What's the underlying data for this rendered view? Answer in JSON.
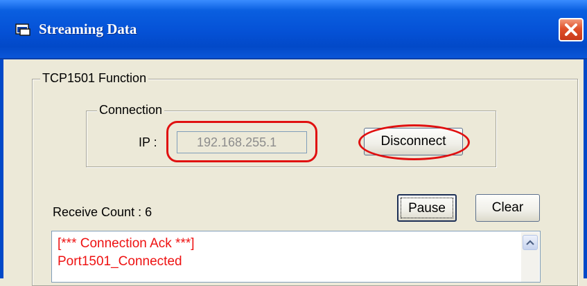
{
  "window": {
    "title": "Streaming Data"
  },
  "function_group": {
    "legend": "TCP1501 Function"
  },
  "connection_group": {
    "legend": "Connection",
    "ip_label": "IP :",
    "ip_value": "192.168.255.1",
    "disconnect_label": "Disconnect"
  },
  "receive": {
    "count_text": "Receive Count : 6",
    "pause_label": "Pause",
    "clear_label": "Clear"
  },
  "log": {
    "lines": [
      "[*** Connection Ack ***]",
      "Port1501_Connected"
    ]
  },
  "colors": {
    "title_bar": "#0551d6",
    "close_button": "#e0502a",
    "highlight": "#e01010",
    "log_text": "#ee1111"
  }
}
